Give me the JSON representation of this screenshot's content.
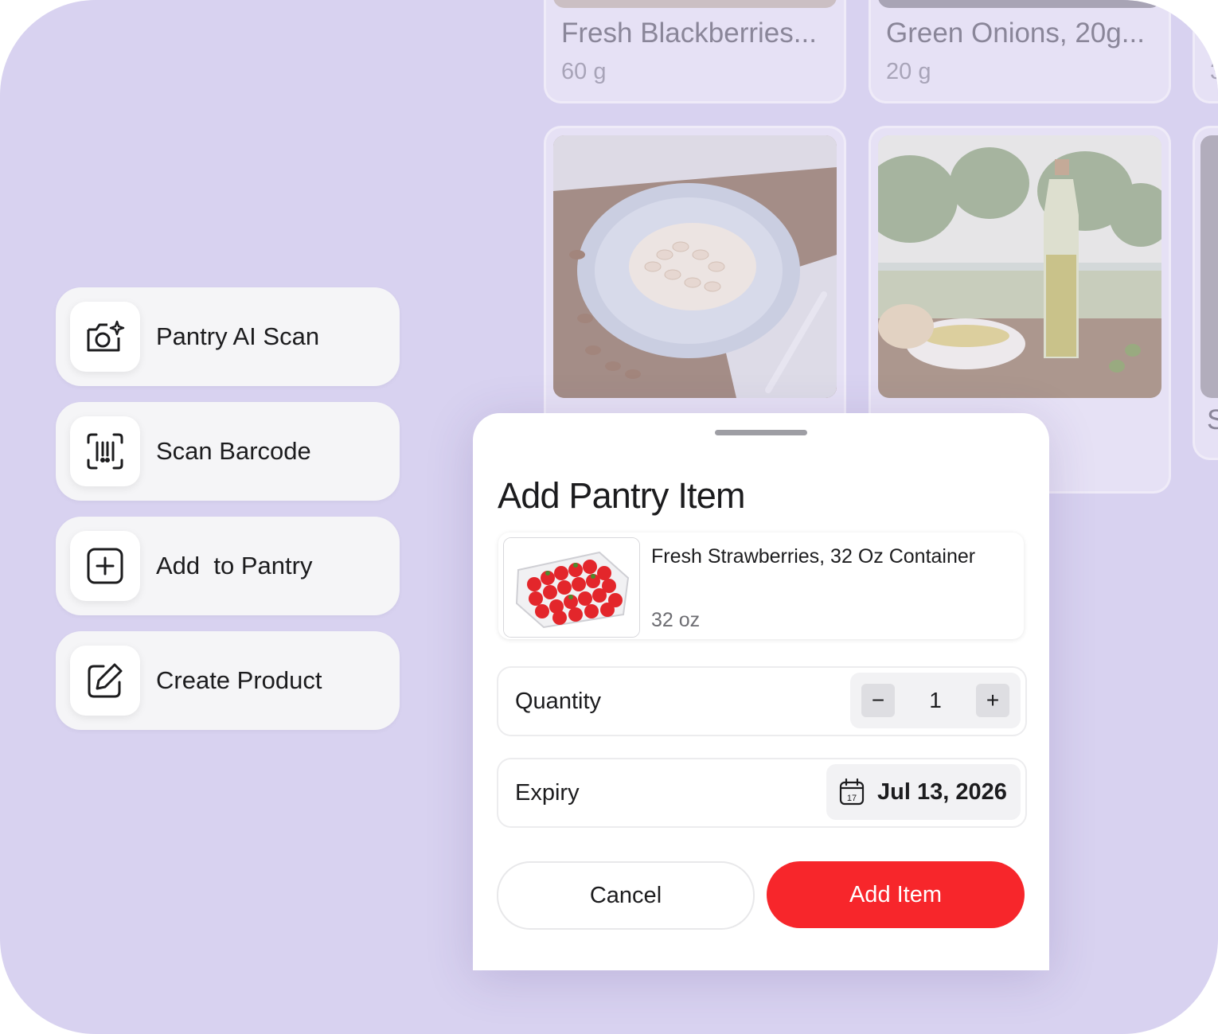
{
  "background_cards": [
    {
      "title": "Fresh Blackberries...",
      "subtitle": "60 g"
    },
    {
      "title": "Green Onions, 20g...",
      "subtitle": "20 g"
    }
  ],
  "partial_card_glyphs": {
    "top_right": "3",
    "middle_right": "S"
  },
  "actions": [
    {
      "label": "Pantry AI Scan",
      "icon": "camera-sparkle-icon"
    },
    {
      "label": "Scan Barcode",
      "icon": "barcode-scan-icon"
    },
    {
      "label": "Add  to Pantry",
      "icon": "plus-square-icon"
    },
    {
      "label": "Create Product",
      "icon": "edit-square-icon"
    }
  ],
  "sheet": {
    "title": "Add Pantry Item",
    "product": {
      "name": "Fresh Strawberries, 32 Oz Container",
      "size": "32 oz"
    },
    "quantity": {
      "label": "Quantity",
      "value": "1",
      "minus": "−",
      "plus": "+"
    },
    "expiry": {
      "label": "Expiry",
      "date": "Jul 13, 2026",
      "calendar_day": "17"
    },
    "cancel_label": "Cancel",
    "add_label": "Add Item"
  },
  "colors": {
    "background": "#d8d2f0",
    "accent": "#f7262b"
  }
}
